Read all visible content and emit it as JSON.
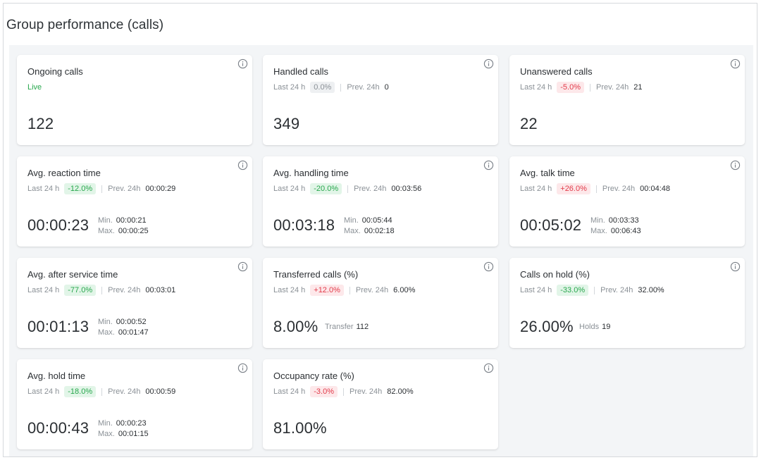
{
  "page": {
    "title": "Group performance (calls)"
  },
  "cards": [
    {
      "title": "Ongoing calls",
      "live": "Live",
      "value": "122"
    },
    {
      "title": "Handled calls",
      "last": "Last 24 h",
      "change": "0.0%",
      "prev_label": "Prev. 24h",
      "prev": "0",
      "value": "349"
    },
    {
      "title": "Unanswered calls",
      "last": "Last 24 h",
      "change": "-5.0%",
      "prev_label": "Prev. 24h",
      "prev": "21",
      "value": "22"
    },
    {
      "title": "Avg. reaction time",
      "last": "Last 24 h",
      "change": "-12.0%",
      "prev_label": "Prev. 24h",
      "prev": "00:00:29",
      "value": "00:00:23",
      "min_label": "Min.",
      "min": "00:00:21",
      "max_label": "Max.",
      "max": "00:00:25"
    },
    {
      "title": "Avg. handling time",
      "last": "Last 24 h",
      "change": "-20.0%",
      "prev_label": "Prev. 24h",
      "prev": "00:03:56",
      "value": "00:03:18",
      "min_label": "Min.",
      "min": "00:05:44",
      "max_label": "Max.",
      "max": "00:02:18"
    },
    {
      "title": "Avg. talk time",
      "last": "Last 24 h",
      "change": "+26.0%",
      "prev_label": "Prev. 24h",
      "prev": "00:04:48",
      "value": "00:05:02",
      "min_label": "Min.",
      "min": "00:03:33",
      "max_label": "Max.",
      "max": "00:06:43"
    },
    {
      "title": "Avg. after service time",
      "last": "Last 24 h",
      "change": "-77.0%",
      "prev_label": "Prev. 24h",
      "prev": "00:03:01",
      "value": "00:01:13",
      "min_label": "Min.",
      "min": "00:00:52",
      "max_label": "Max.",
      "max": "00:01:47"
    },
    {
      "title": "Transferred calls (%)",
      "last": "Last 24 h",
      "change": "+12.0%",
      "prev_label": "Prev. 24h",
      "prev": "6.00%",
      "value": "8.00%",
      "extra_label": "Transfer",
      "extra": "112"
    },
    {
      "title": "Calls on hold (%)",
      "last": "Last 24 h",
      "change": "-33.0%",
      "prev_label": "Prev. 24h",
      "prev": "32.00%",
      "value": "26.00%",
      "extra_label": "Holds",
      "extra": "19"
    },
    {
      "title": "Avg. hold time",
      "last": "Last 24 h",
      "change": "-18.0%",
      "prev_label": "Prev. 24h",
      "prev": "00:00:59",
      "value": "00:00:43",
      "min_label": "Min.",
      "min": "00:00:23",
      "max_label": "Max.",
      "max": "00:01:15"
    },
    {
      "title": "Occupancy rate (%)",
      "last": "Last 24 h",
      "change": "-3.0%",
      "prev_label": "Prev. 24h",
      "prev": "82.00%",
      "value": "81.00%"
    }
  ],
  "colors": {
    "good": "#27a74c",
    "bad": "#e23b4a",
    "neutral": "#8a9096",
    "info_icon": "#7a8088"
  },
  "icons": {
    "info": "info-circle-icon"
  }
}
